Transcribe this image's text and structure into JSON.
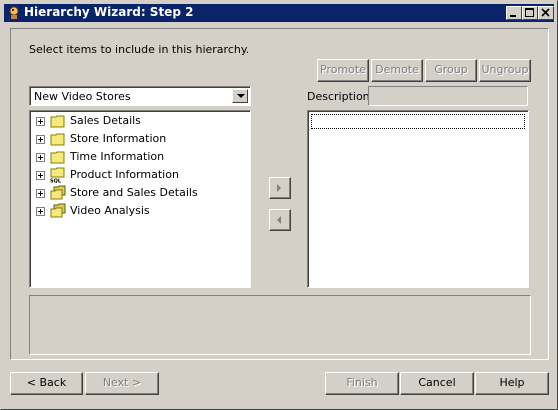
{
  "window": {
    "title": "Hierarchy Wizard: Step 2",
    "icons": {
      "app": "wizard-icon",
      "minimize": "minimize-icon",
      "maximize": "maximize-icon",
      "close": "close-icon"
    }
  },
  "instruction": "Select items to include in this hierarchy.",
  "toolbar": {
    "promote": "Promote",
    "demote": "Demote",
    "group": "Group",
    "ungroup": "Ungroup"
  },
  "source_combo": {
    "value": "New Video Stores"
  },
  "tree": {
    "items": [
      {
        "label": "Sales Details",
        "icon": "folder-icon"
      },
      {
        "label": "Store Information",
        "icon": "folder-icon"
      },
      {
        "label": "Time Information",
        "icon": "folder-icon"
      },
      {
        "label": "Product Information",
        "icon": "sql-folder-icon"
      },
      {
        "label": "Store and Sales Details",
        "icon": "multi-folder-icon"
      },
      {
        "label": "Video Analysis",
        "icon": "multi-folder-icon"
      }
    ]
  },
  "description": {
    "label": "Description:",
    "value": ""
  },
  "move_buttons": {
    "add_icon": "right-arrow-icon",
    "remove_icon": "left-arrow-icon"
  },
  "footer": {
    "back": "< Back",
    "next": "Next >",
    "finish": "Finish",
    "cancel": "Cancel",
    "help": "Help"
  },
  "colors": {
    "titlebar": "#0a246a",
    "face": "#d4d0c8",
    "disabled_text": "#808080"
  }
}
